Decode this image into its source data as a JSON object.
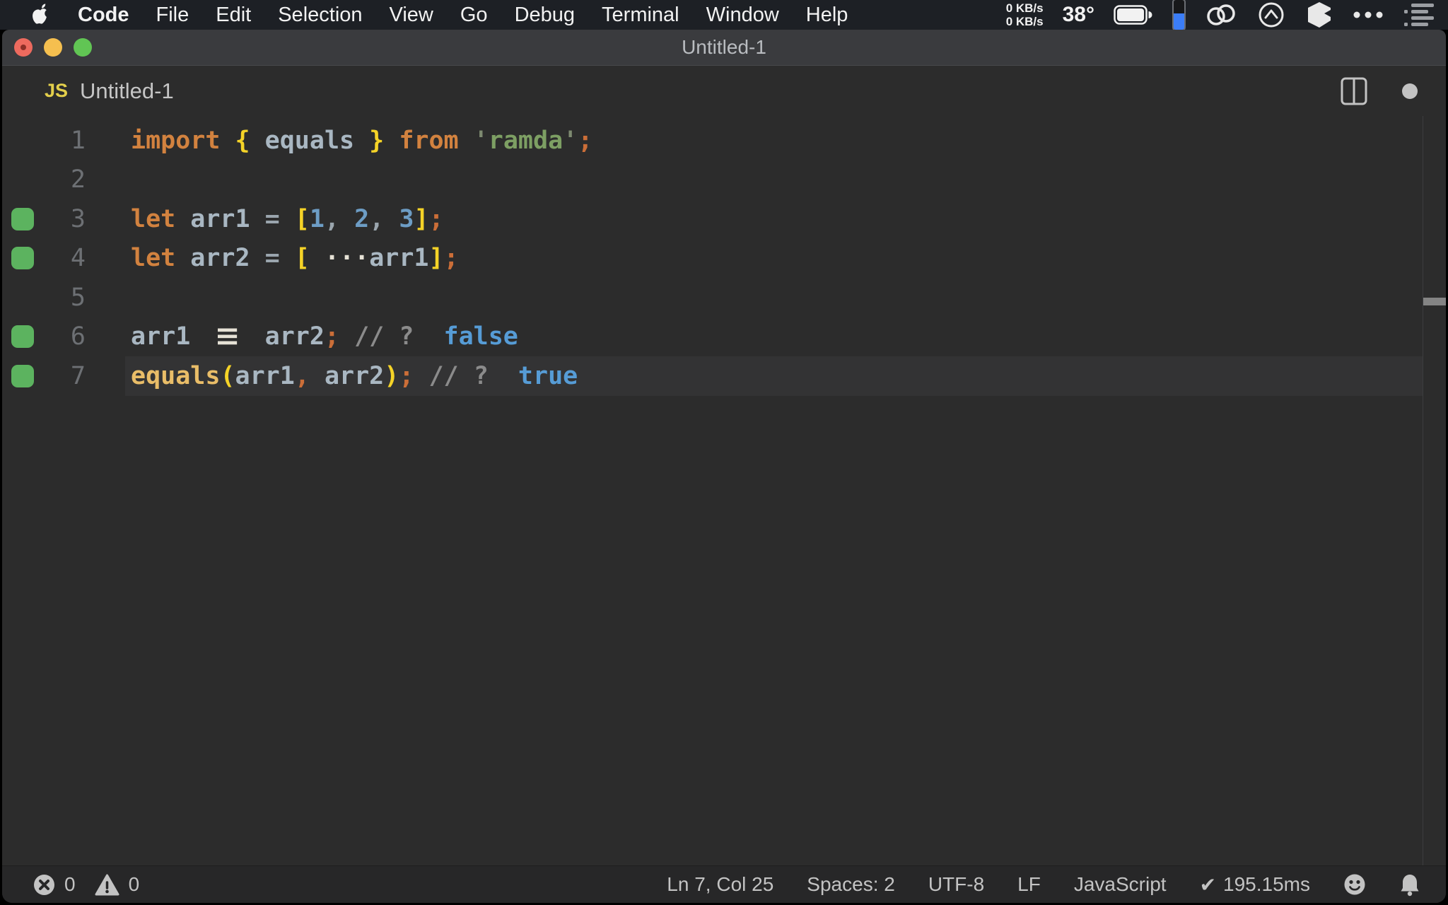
{
  "menubar": {
    "app_name": "Code",
    "items": [
      "File",
      "Edit",
      "Selection",
      "View",
      "Go",
      "Debug",
      "Terminal",
      "Window",
      "Help"
    ],
    "net_up": "0 KB/s",
    "net_down": "0 KB/s",
    "temperature": "38°"
  },
  "window": {
    "title": "Untitled-1"
  },
  "tab": {
    "badge": "JS",
    "name": "Untitled-1"
  },
  "editor": {
    "background": "#2c2c2c",
    "marker_color": "#5cb35f",
    "source_text": [
      "import { equals } from 'ramda';",
      "",
      "let arr1 = [1, 2, 3];",
      "let arr2 = [ ...arr1];",
      "",
      "arr1 === arr2; // ?  false",
      "equals(arr1, arr2); // ?  true"
    ],
    "lines": [
      {
        "num": "1",
        "marker": false,
        "current": false,
        "tokens": [
          [
            "kw",
            "import"
          ],
          [
            "plain",
            " "
          ],
          [
            "brace",
            "{"
          ],
          [
            "var",
            " equals "
          ],
          [
            "brace",
            "}"
          ],
          [
            "plain",
            " "
          ],
          [
            "kw",
            "from"
          ],
          [
            "plain",
            " "
          ],
          [
            "strq",
            "'"
          ],
          [
            "str",
            "ramda"
          ],
          [
            "strq",
            "'"
          ],
          [
            "semi",
            ";"
          ]
        ]
      },
      {
        "num": "2",
        "marker": false,
        "current": false,
        "tokens": []
      },
      {
        "num": "3",
        "marker": true,
        "current": false,
        "tokens": [
          [
            "kw",
            "let"
          ],
          [
            "var",
            " arr1 "
          ],
          [
            "op",
            "="
          ],
          [
            "plain",
            " "
          ],
          [
            "brace",
            "["
          ],
          [
            "num",
            "1"
          ],
          [
            "comma",
            ","
          ],
          [
            "num",
            " 2"
          ],
          [
            "comma",
            ","
          ],
          [
            "num",
            " 3"
          ],
          [
            "brace",
            "]"
          ],
          [
            "semi",
            ";"
          ]
        ]
      },
      {
        "num": "4",
        "marker": true,
        "current": false,
        "tokens": [
          [
            "kw",
            "let"
          ],
          [
            "var",
            " arr2 "
          ],
          [
            "op",
            "="
          ],
          [
            "plain",
            " "
          ],
          [
            "brace",
            "["
          ],
          [
            "plain",
            " "
          ],
          [
            "lig",
            "···"
          ],
          [
            "var",
            "arr1"
          ],
          [
            "brace",
            "]"
          ],
          [
            "semi",
            ";"
          ]
        ]
      },
      {
        "num": "5",
        "marker": false,
        "current": false,
        "tokens": []
      },
      {
        "num": "6",
        "marker": true,
        "current": false,
        "tokens": [
          [
            "var",
            "arr1 "
          ],
          [
            "lig3",
            "≡"
          ],
          [
            "var",
            " arr2"
          ],
          [
            "semi",
            ";"
          ],
          [
            "comment",
            " // ?  "
          ],
          [
            "result",
            "false"
          ]
        ]
      },
      {
        "num": "7",
        "marker": true,
        "current": true,
        "tokens": [
          [
            "fn",
            "equals"
          ],
          [
            "brace",
            "("
          ],
          [
            "var",
            "arr1"
          ],
          [
            "semi",
            ","
          ],
          [
            "var",
            " arr2"
          ],
          [
            "brace",
            ")"
          ],
          [
            "semi",
            ";"
          ],
          [
            "comment",
            " // ?  "
          ],
          [
            "result",
            "true"
          ]
        ]
      }
    ]
  },
  "statusbar": {
    "errors": "0",
    "warnings": "0",
    "items": [
      "Ln 7, Col 25",
      "Spaces: 2",
      "UTF-8",
      "LF",
      "JavaScript"
    ],
    "check": "✔",
    "time": "195.15ms"
  }
}
